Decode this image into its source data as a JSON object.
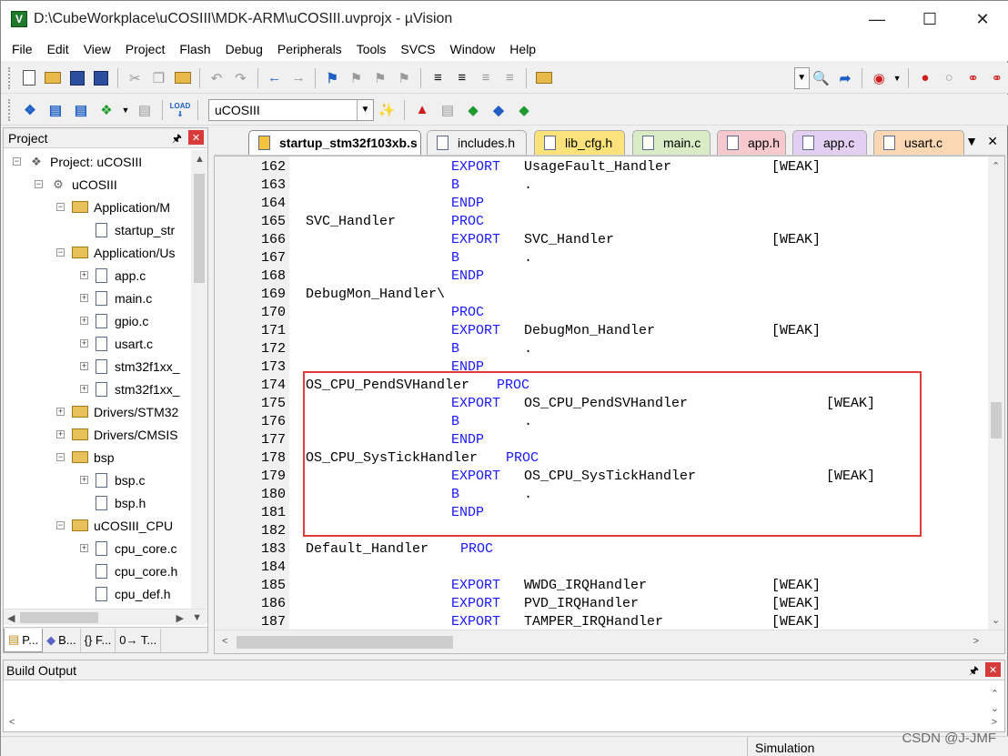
{
  "window": {
    "title": "D:\\CubeWorkplace\\uCOSIII\\MDK-ARM\\uCOSIII.uvprojx - µVision",
    "app_icon": "V"
  },
  "menu": [
    "File",
    "Edit",
    "View",
    "Project",
    "Flash",
    "Debug",
    "Peripherals",
    "Tools",
    "SVCS",
    "Window",
    "Help"
  ],
  "toolbar": {
    "target_name": "uCOSIII",
    "load_label": "LOAD"
  },
  "project_panel": {
    "title": "Project",
    "tree": [
      {
        "label": "Project: uCOSIII",
        "type": "project",
        "indent": 0,
        "exp": "-"
      },
      {
        "label": "uCOSIII",
        "type": "target",
        "indent": 1,
        "exp": "-"
      },
      {
        "label": "Application/M",
        "type": "folder",
        "indent": 2,
        "exp": "-"
      },
      {
        "label": "startup_str",
        "type": "file",
        "indent": 3,
        "exp": ""
      },
      {
        "label": "Application/Us",
        "type": "folder",
        "indent": 2,
        "exp": "-"
      },
      {
        "label": "app.c",
        "type": "file",
        "indent": 3,
        "exp": "+"
      },
      {
        "label": "main.c",
        "type": "file",
        "indent": 3,
        "exp": "+"
      },
      {
        "label": "gpio.c",
        "type": "file",
        "indent": 3,
        "exp": "+"
      },
      {
        "label": "usart.c",
        "type": "file",
        "indent": 3,
        "exp": "+"
      },
      {
        "label": "stm32f1xx_",
        "type": "file",
        "indent": 3,
        "exp": "+"
      },
      {
        "label": "stm32f1xx_",
        "type": "file",
        "indent": 3,
        "exp": "+"
      },
      {
        "label": "Drivers/STM32",
        "type": "folder",
        "indent": 2,
        "exp": "+"
      },
      {
        "label": "Drivers/CMSIS",
        "type": "folder",
        "indent": 2,
        "exp": "+"
      },
      {
        "label": "bsp",
        "type": "folder",
        "indent": 2,
        "exp": "-"
      },
      {
        "label": "bsp.c",
        "type": "file",
        "indent": 3,
        "exp": "+"
      },
      {
        "label": "bsp.h",
        "type": "file",
        "indent": 3,
        "exp": ""
      },
      {
        "label": "uCOSIII_CPU",
        "type": "folder",
        "indent": 2,
        "exp": "-"
      },
      {
        "label": "cpu_core.c",
        "type": "file",
        "indent": 3,
        "exp": "+"
      },
      {
        "label": "cpu_core.h",
        "type": "file",
        "indent": 3,
        "exp": ""
      },
      {
        "label": "cpu_def.h",
        "type": "file",
        "indent": 3,
        "exp": ""
      }
    ],
    "bottom_tabs": [
      "P...",
      "B...",
      "{} F...",
      "0→ T..."
    ]
  },
  "editor": {
    "tabs": [
      {
        "label": "startup_stm32f103xb.s",
        "active": true,
        "color": "#f5c23e"
      },
      {
        "label": "includes.h",
        "active": false,
        "color": "#f0f0f0"
      },
      {
        "label": "lib_cfg.h",
        "active": false,
        "color": "#fbe27a"
      },
      {
        "label": "main.c",
        "active": false,
        "color": "#d9ecc6"
      },
      {
        "label": "app.h",
        "active": false,
        "color": "#f6c9cf"
      },
      {
        "label": "app.c",
        "active": false,
        "color": "#e3cff2"
      },
      {
        "label": "usart.c",
        "active": false,
        "color": "#fbd7b4"
      }
    ],
    "lines": [
      {
        "n": "162",
        "label": "",
        "kw": "EXPORT",
        "arg": "UsageFault_Handler",
        "ann": "[WEAK]",
        "kwpos": "i"
      },
      {
        "n": "163",
        "label": "",
        "kw": "B",
        "arg": ".",
        "ann": "",
        "kwpos": "i"
      },
      {
        "n": "164",
        "label": "",
        "kw": "ENDP",
        "arg": "",
        "ann": "",
        "kwpos": "i"
      },
      {
        "n": "165",
        "label": "SVC_Handler",
        "kw": "PROC",
        "arg": "",
        "ann": "",
        "kwpos": "i"
      },
      {
        "n": "166",
        "label": "",
        "kw": "EXPORT",
        "arg": "SVC_Handler",
        "ann": "[WEAK]",
        "kwpos": "i"
      },
      {
        "n": "167",
        "label": "",
        "kw": "B",
        "arg": ".",
        "ann": "",
        "kwpos": "i"
      },
      {
        "n": "168",
        "label": "",
        "kw": "ENDP",
        "arg": "",
        "ann": "",
        "kwpos": "i"
      },
      {
        "n": "169",
        "label": "DebugMon_Handler\\",
        "kw": "",
        "arg": "",
        "ann": "",
        "kwpos": "i"
      },
      {
        "n": "170",
        "label": "",
        "kw": "PROC",
        "arg": "",
        "ann": "",
        "kwpos": "i"
      },
      {
        "n": "171",
        "label": "",
        "kw": "EXPORT",
        "arg": "DebugMon_Handler",
        "ann": "[WEAK]",
        "kwpos": "i"
      },
      {
        "n": "172",
        "label": "",
        "kw": "B",
        "arg": ".",
        "ann": "",
        "kwpos": "i"
      },
      {
        "n": "173",
        "label": "",
        "kw": "ENDP",
        "arg": "",
        "ann": "",
        "kwpos": "i"
      },
      {
        "n": "174",
        "label": "OS_CPU_PendSVHandler",
        "kw": "PROC",
        "arg": "",
        "ann": "",
        "kwpos": "after"
      },
      {
        "n": "175",
        "label": "",
        "kw": "EXPORT",
        "arg": "OS_CPU_PendSVHandler",
        "ann": "[WEAK]",
        "kwpos": "i",
        "annpos": "far"
      },
      {
        "n": "176",
        "label": "",
        "kw": "B",
        "arg": ".",
        "ann": "",
        "kwpos": "i"
      },
      {
        "n": "177",
        "label": "",
        "kw": "ENDP",
        "arg": "",
        "ann": "",
        "kwpos": "i"
      },
      {
        "n": "178",
        "label": "OS_CPU_SysTickHandler",
        "kw": "PROC",
        "arg": "",
        "ann": "",
        "kwpos": "after"
      },
      {
        "n": "179",
        "label": "",
        "kw": "EXPORT",
        "arg": "OS_CPU_SysTickHandler",
        "ann": "[WEAK]",
        "kwpos": "i",
        "annpos": "far"
      },
      {
        "n": "180",
        "label": "",
        "kw": "B",
        "arg": ".",
        "ann": "",
        "kwpos": "i"
      },
      {
        "n": "181",
        "label": "",
        "kw": "ENDP",
        "arg": "",
        "ann": "",
        "kwpos": "i"
      },
      {
        "n": "182",
        "label": "",
        "kw": "",
        "arg": "",
        "ann": "",
        "kwpos": "i"
      },
      {
        "n": "183",
        "label": "Default_Handler",
        "kw": "PROC",
        "arg": "",
        "ann": "",
        "kwpos": "after"
      },
      {
        "n": "184",
        "label": "",
        "kw": "",
        "arg": "",
        "ann": "",
        "kwpos": "i"
      },
      {
        "n": "185",
        "label": "",
        "kw": "EXPORT",
        "arg": "WWDG_IRQHandler",
        "ann": "[WEAK]",
        "kwpos": "i"
      },
      {
        "n": "186",
        "label": "",
        "kw": "EXPORT",
        "arg": "PVD_IRQHandler",
        "ann": "[WEAK]",
        "kwpos": "i"
      },
      {
        "n": "187",
        "label": "",
        "kw": "EXPORT",
        "arg": "TAMPER_IRQHandler",
        "ann": "[WEAK]",
        "kwpos": "i"
      }
    ]
  },
  "build_output": {
    "title": "Build Output",
    "content": ""
  },
  "status": {
    "mode": "Simulation"
  },
  "watermark": "CSDN @J-JMF",
  "colors": {
    "keyword": "#1a1aff",
    "highlight_border": "#e03c3c",
    "active_tab": "#f5c23e"
  }
}
